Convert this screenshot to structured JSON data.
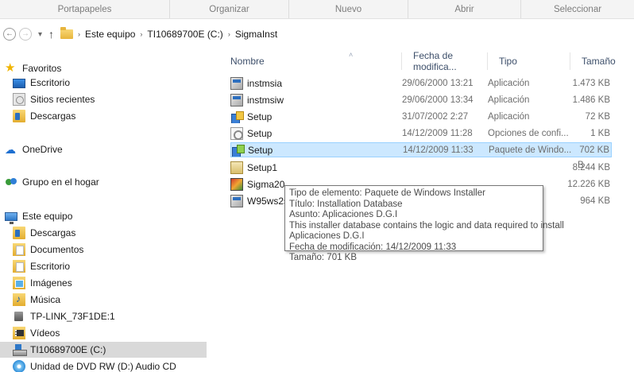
{
  "ribbon": {
    "groups": [
      "Portapapeles",
      "Organizar",
      "Nuevo",
      "Abrir",
      "Seleccionar"
    ]
  },
  "nav": {
    "back_glyph": "←",
    "forward_glyph": "→",
    "recent_glyph": "▾",
    "up_glyph": "↑"
  },
  "breadcrumb": {
    "sep": "›",
    "items": [
      "Este equipo",
      "TI10689700E (C:)",
      "SigmaInst"
    ]
  },
  "sidebar": {
    "items": [
      {
        "label": "Favoritos",
        "icon": "star-icon"
      },
      {
        "label": "Escritorio",
        "icon": "desktop-icon"
      },
      {
        "label": "Sitios recientes",
        "icon": "recent-places-icon"
      },
      {
        "label": "Descargas",
        "icon": "downloads-icon"
      },
      {
        "label": "OneDrive",
        "icon": "onedrive-icon"
      },
      {
        "label": "Grupo en el hogar",
        "icon": "homegroup-icon"
      },
      {
        "label": "Este equipo",
        "icon": "computer-icon"
      },
      {
        "label": "Descargas",
        "icon": "downloads-icon"
      },
      {
        "label": "Documentos",
        "icon": "documents-icon"
      },
      {
        "label": "Escritorio",
        "icon": "desktop-icon"
      },
      {
        "label": "Imágenes",
        "icon": "pictures-icon"
      },
      {
        "label": "Música",
        "icon": "music-icon"
      },
      {
        "label": "TP-LINK_73F1DE:1",
        "icon": "network-device-icon"
      },
      {
        "label": "Vídeos",
        "icon": "videos-icon"
      },
      {
        "label": "TI10689700E (C:)",
        "icon": "drive-icon"
      },
      {
        "label": "Unidad de DVD RW (D:) Audio CD",
        "icon": "dvd-icon"
      }
    ]
  },
  "columns": {
    "sort_glyph": "˄",
    "name": "Nombre",
    "date": "Fecha de modifica...",
    "type": "Tipo",
    "size": "Tamaño"
  },
  "files": [
    {
      "name": "instmsia",
      "date": "29/06/2000 13:21",
      "type": "Aplicación",
      "size": "1.473 KB",
      "icon": "application-icon"
    },
    {
      "name": "instmsiw",
      "date": "29/06/2000 13:34",
      "type": "Aplicación",
      "size": "1.486 KB",
      "icon": "application-icon"
    },
    {
      "name": "Setup",
      "date": "31/07/2002 2:27",
      "type": "Aplicación",
      "size": "72 KB",
      "icon": "setup-exe-icon"
    },
    {
      "name": "Setup",
      "date": "14/12/2009 11:28",
      "type": "Opciones de confi...",
      "size": "1 KB",
      "icon": "config-settings-icon"
    },
    {
      "name": "Setup",
      "date": "14/12/2009 11:33",
      "type": "Paquete de Windo...",
      "size": "702 KB",
      "icon": "msi-package-icon"
    },
    {
      "name": "Setup1",
      "date": "",
      "type": "",
      "size": "8.244 KB",
      "icon": "cabinet-icon"
    },
    {
      "name": "Sigma20",
      "date": "",
      "type": "",
      "size": "12.226 KB",
      "icon": "sigma-app-icon"
    },
    {
      "name": "W95ws2se",
      "date": "",
      "type": "",
      "size": "964 KB",
      "icon": "application-icon"
    }
  ],
  "tooltip": {
    "lines": [
      "Tipo de elemento: Paquete de Windows Installer",
      "Título: Installation Database",
      "Asunto: Aplicaciones D.G.I",
      "This installer database contains the logic and data required to install",
      "Aplicaciones D.G.I",
      "Fecha de modificación: 14/12/2009 11:33",
      "Tamaño: 701 KB"
    ],
    "peek_text": "B"
  }
}
